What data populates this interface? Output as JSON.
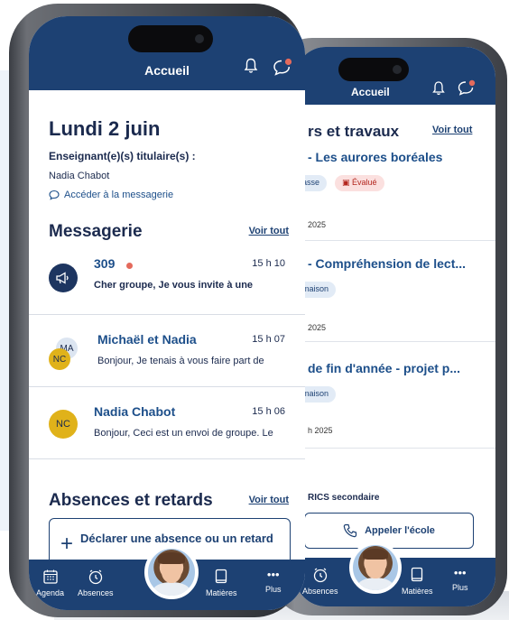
{
  "back_phone": {
    "header": {
      "title": "Accueil"
    },
    "section_title": "rs et travaux",
    "voir_tout": "Voir tout",
    "items": [
      {
        "title": "- Les aurores boréales",
        "chips": [
          "asse",
          "Évalué"
        ],
        "date": "2025"
      },
      {
        "title": "- Compréhension de lect...",
        "chips": [
          "maison"
        ],
        "date": "2025"
      },
      {
        "title": "de fin d'année - projet p...",
        "chips": [
          "maison"
        ],
        "date": "h 2025"
      }
    ],
    "footer_label": "RICS secondaire",
    "call_button": "Appeler l'école",
    "nav": {
      "absences": "Absences",
      "matieres": "Matières",
      "plus": "Plus"
    }
  },
  "front_phone": {
    "header": {
      "title": "Accueil"
    },
    "date_title": "Lundi 2 juin",
    "teacher_label": "Enseignant(e)(s) titulaire(s) :",
    "teacher_name": "Nadia Chabot",
    "messaging_link": "Accéder à la messagerie",
    "messagerie": {
      "title": "Messagerie",
      "voir_tout": "Voir tout",
      "messages": [
        {
          "sender": "309",
          "time": "15 h 10",
          "preview": "Cher groupe, Je vous invite à une",
          "unread": true,
          "icon": "megaphone-icon"
        },
        {
          "sender": "Michaël et Nadia",
          "time": "15 h 07",
          "preview": "Bonjour, Je tenais à vous faire part de",
          "initials_back": "MA",
          "initials_front": "NC"
        },
        {
          "sender": "Nadia Chabot",
          "time": "15 h 06",
          "preview": "Bonjour, Ceci est un envoi de groupe. Le",
          "initials": "NC"
        }
      ]
    },
    "absences": {
      "title": "Absences et retards",
      "voir_tout": "Voir tout",
      "declare_button": "Déclarer une absence ou un retard"
    },
    "nav": {
      "agenda": "Agenda",
      "absences": "Absences",
      "matieres": "Matières",
      "plus": "Plus"
    }
  },
  "colors": {
    "primary": "#1d4173",
    "link": "#1d4f8a",
    "unread": "#e46a5c",
    "avatar_yellow": "#e0b21a"
  }
}
